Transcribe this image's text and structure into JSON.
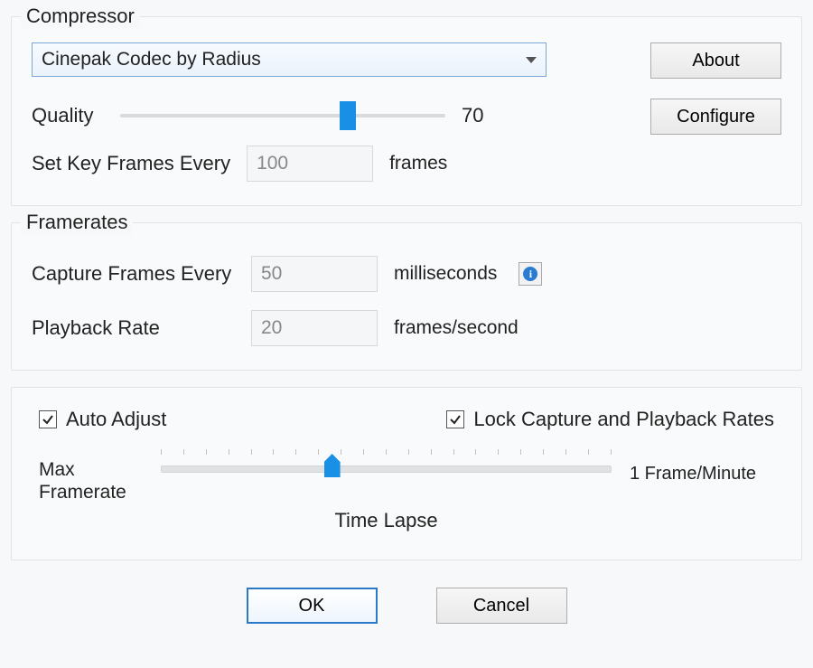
{
  "compressor": {
    "title": "Compressor",
    "codec_selected": "Cinepak Codec by Radius",
    "about_label": "About",
    "configure_label": "Configure",
    "quality_label": "Quality",
    "quality_value": "70",
    "quality_percent": 70,
    "keyframes_label": "Set Key Frames Every",
    "keyframes_value": "100",
    "keyframes_unit": "frames"
  },
  "framerates": {
    "title": "Framerates",
    "capture_label": "Capture Frames Every",
    "capture_value": "50",
    "capture_unit": "milliseconds",
    "playback_label": "Playback Rate",
    "playback_value": "20",
    "playback_unit": "frames/second"
  },
  "adjust": {
    "auto_adjust_label": "Auto Adjust",
    "auto_adjust_checked": true,
    "lock_rates_label": "Lock Capture and Playback Rates",
    "lock_rates_checked": true,
    "max_framerate_label": "Max Framerate",
    "slider_position_percent": 38,
    "slider_end_label": "1 Frame/Minute",
    "caption": "Time Lapse"
  },
  "footer": {
    "ok_label": "OK",
    "cancel_label": "Cancel"
  }
}
